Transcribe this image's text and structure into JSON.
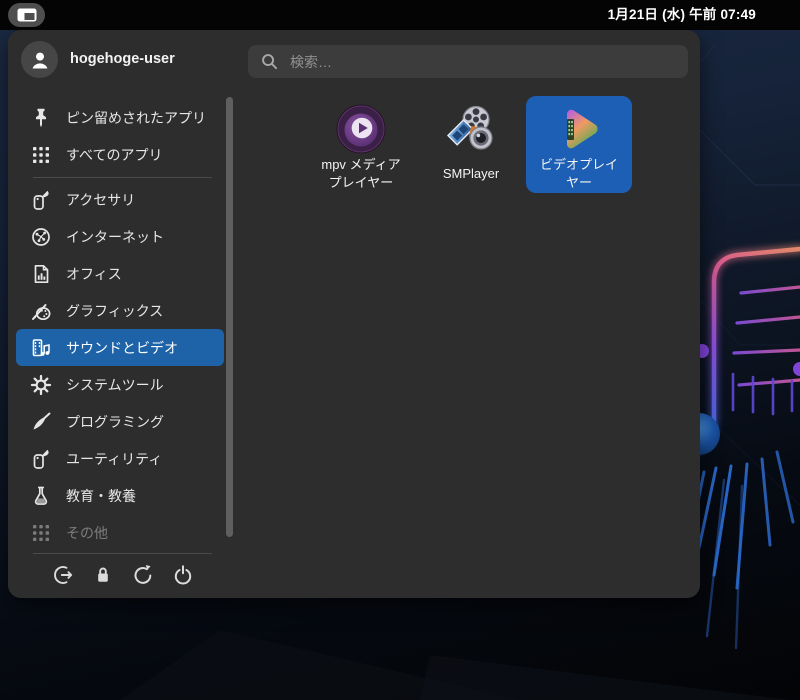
{
  "topbar": {
    "clock": "1月21日 (水) 午前 07:49"
  },
  "menu": {
    "user": {
      "name": "hogehoge-user"
    },
    "search": {
      "placeholder": "検索…"
    },
    "sidebar": {
      "items": [
        {
          "label": "ピン留めされたアプリ",
          "icon": "pin-icon",
          "selected": false
        },
        {
          "label": "すべてのアプリ",
          "icon": "all-apps-grid-icon",
          "selected": false
        },
        {
          "label": "アクセサリ",
          "icon": "accessories-knife-icon",
          "selected": false
        },
        {
          "label": "インターネット",
          "icon": "internet-globe-icon",
          "selected": false
        },
        {
          "label": "オフィス",
          "icon": "office-document-icon",
          "selected": false
        },
        {
          "label": "グラフィックス",
          "icon": "graphics-palette-icon",
          "selected": false
        },
        {
          "label": "サウンドとビデオ",
          "icon": "sound-video-icon",
          "selected": true
        },
        {
          "label": "システムツール",
          "icon": "system-gear-icon",
          "selected": false
        },
        {
          "label": "プログラミング",
          "icon": "programming-trowel-icon",
          "selected": false
        },
        {
          "label": "ユーティリティ",
          "icon": "utilities-knife-icon",
          "selected": false
        },
        {
          "label": "教育・教養",
          "icon": "education-flask-icon",
          "selected": false
        },
        {
          "label": "その他",
          "icon": "other-grid-icon",
          "selected": false,
          "dimmed": true
        }
      ]
    },
    "apps": [
      {
        "label": "mpv メディア\nプレイヤー",
        "icon": "mpv-icon",
        "selected": false
      },
      {
        "label": "SMPlayer",
        "icon": "smplayer-icon",
        "selected": false
      },
      {
        "label": "ビデオプレイ\nヤー",
        "icon": "video-player-icon",
        "selected": true
      }
    ],
    "session_actions": [
      {
        "name": "logout"
      },
      {
        "name": "lock"
      },
      {
        "name": "restart"
      },
      {
        "name": "shutdown"
      }
    ]
  },
  "colors": {
    "sidebar_accent": "#1e63a8",
    "tile_accent": "#1d5fb5",
    "panel_bg": "#2d2d2d",
    "topbar_bg": "#040404",
    "search_bg": "#3c3c3c"
  }
}
